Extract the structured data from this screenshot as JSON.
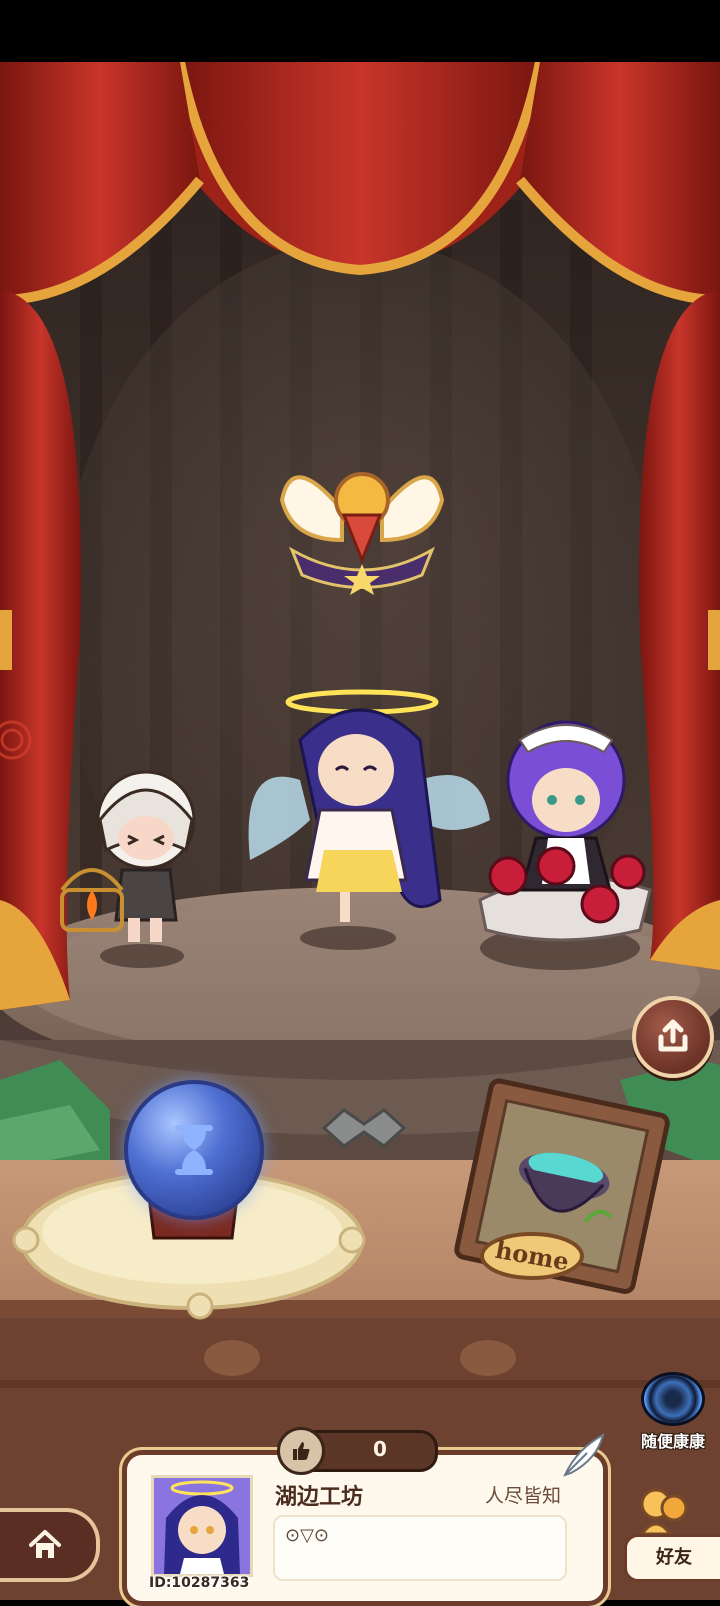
{
  "stage": {
    "share_icon": "share-upload-icon",
    "hourglass_icon": "hourglass-icon",
    "home_frame_label": "home"
  },
  "side": {
    "random_cure_label": "随便康康",
    "random_cure_icon": "portal-icon"
  },
  "profile": {
    "like_count": "0",
    "like_icon": "thumbs-up-icon",
    "name": "湖边工坊",
    "title": "人尽皆知",
    "signature": "⊙▽⊙",
    "id": "ID:10287363",
    "quill_icon": "quill-icon"
  },
  "nav": {
    "home_icon": "home-icon",
    "friends_label": "好友",
    "friends_icon": "friends-icon"
  },
  "colors": {
    "curtain": "#a8261c",
    "curtain_trim": "#e6a53c",
    "stage_wall": "#3e312c",
    "stage_floor": "#8a7366",
    "card_border": "#6b3c2a"
  }
}
